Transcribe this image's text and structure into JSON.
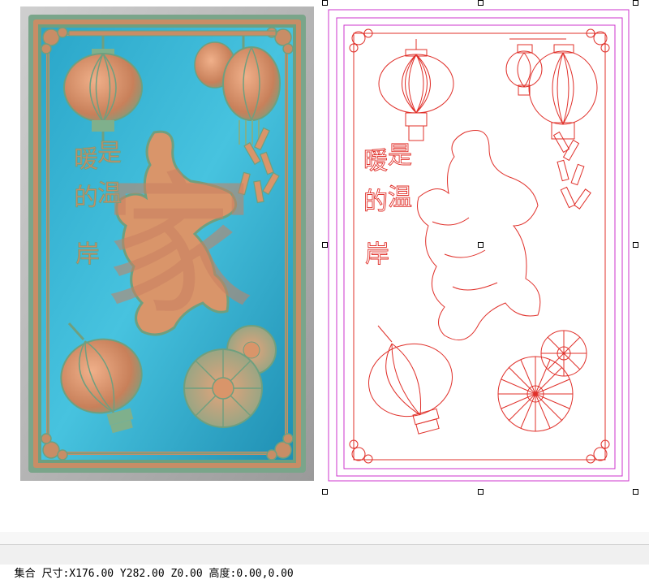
{
  "artwork": {
    "character_main": "家",
    "poem_col1": "暖是",
    "poem_col2": "的温",
    "poem_col3": "岸",
    "poem_chars": [
      "暖",
      "是",
      "的",
      "温",
      "岸"
    ]
  },
  "status_bar": {
    "text": "集合 尺寸:X176.00 Y282.00 Z0.00 高度:0.00,0.00"
  },
  "colors": {
    "relief_bg": "#3fb8d8",
    "relief_frame": "#6e9a7e",
    "relief_orange": "#d9956a",
    "vector_red": "#e0302a",
    "vector_frame": "#cc33cc",
    "selection_handle": "#000000"
  },
  "icons": [
    "selection-handle-icon"
  ]
}
